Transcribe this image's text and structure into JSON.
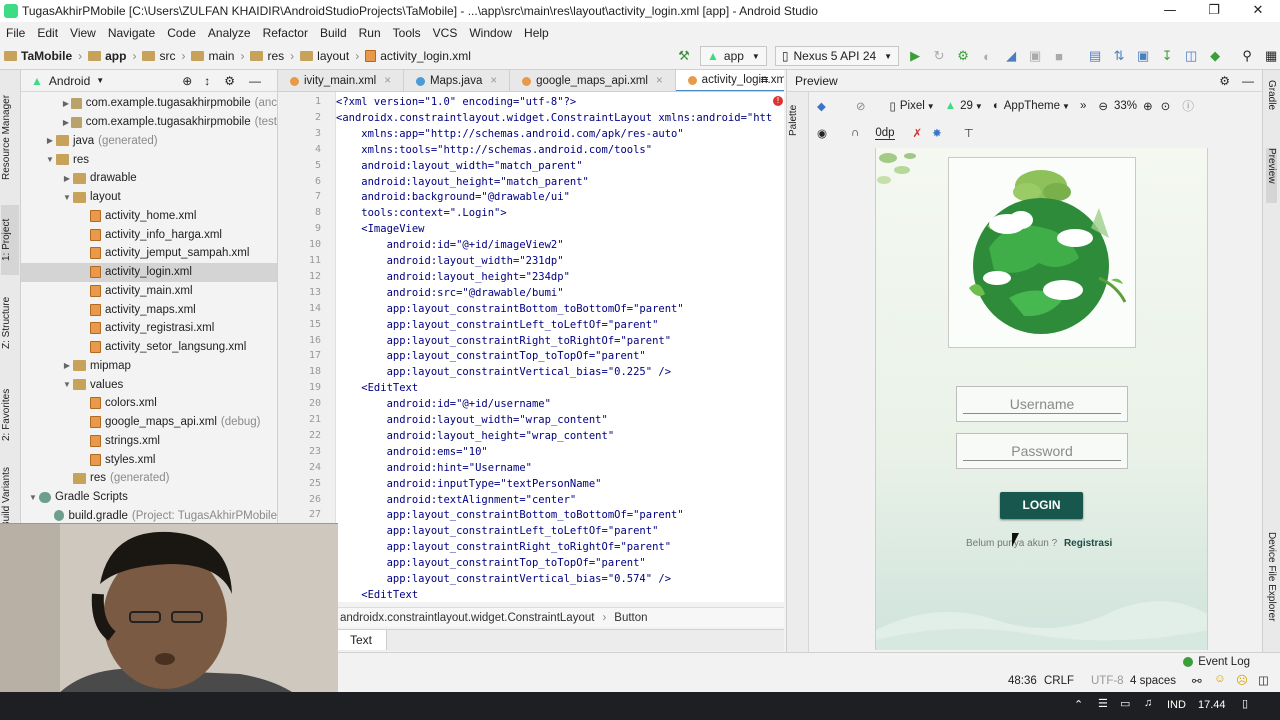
{
  "window": {
    "title": "TugasAkhirPMobile [C:\\Users\\ZULFAN KHAIDIR\\AndroidStudioProjects\\TaMobile] - ...\\app\\src\\main\\res\\layout\\activity_login.xml [app] - Android Studio",
    "minimize_icon": "minimize-icon",
    "restore_icon": "restore-icon",
    "close_icon": "close-icon"
  },
  "menu": [
    "File",
    "Edit",
    "View",
    "Navigate",
    "Code",
    "Analyze",
    "Refactor",
    "Build",
    "Run",
    "Tools",
    "VCS",
    "Window",
    "Help"
  ],
  "breadcrumb": [
    "TaMobile",
    "app",
    "src",
    "main",
    "res",
    "layout",
    "activity_login.xml"
  ],
  "toolbar": {
    "config": "app",
    "device": "Nexus 5 API 24"
  },
  "project_panel": {
    "view": "Android",
    "tree": [
      {
        "label": "com.example.tugasakhirpmobile",
        "suffix": "(anc",
        "depth": 2,
        "arrow": "▶",
        "icon": "pkg"
      },
      {
        "label": "com.example.tugasakhirpmobile",
        "suffix": "(test",
        "depth": 2,
        "arrow": "▶",
        "icon": "pkg"
      },
      {
        "label": "java",
        "suffix": "(generated)",
        "depth": 1,
        "arrow": "▶",
        "icon": "folder-c"
      },
      {
        "label": "res",
        "suffix": "",
        "depth": 1,
        "arrow": "▼",
        "icon": "folder-c"
      },
      {
        "label": "drawable",
        "suffix": "",
        "depth": 2,
        "arrow": "▶",
        "icon": "folder-c"
      },
      {
        "label": "layout",
        "suffix": "",
        "depth": 2,
        "arrow": "▼",
        "icon": "folder-c"
      },
      {
        "label": "activity_home.xml",
        "suffix": "",
        "depth": 3,
        "arrow": "",
        "icon": "xml"
      },
      {
        "label": "activity_info_harga.xml",
        "suffix": "",
        "depth": 3,
        "arrow": "",
        "icon": "xml"
      },
      {
        "label": "activity_jemput_sampah.xml",
        "suffix": "",
        "depth": 3,
        "arrow": "",
        "icon": "xml"
      },
      {
        "label": "activity_login.xml",
        "suffix": "",
        "depth": 3,
        "arrow": "",
        "icon": "xml",
        "selected": true
      },
      {
        "label": "activity_main.xml",
        "suffix": "",
        "depth": 3,
        "arrow": "",
        "icon": "xml"
      },
      {
        "label": "activity_maps.xml",
        "suffix": "",
        "depth": 3,
        "arrow": "",
        "icon": "xml"
      },
      {
        "label": "activity_registrasi.xml",
        "suffix": "",
        "depth": 3,
        "arrow": "",
        "icon": "xml"
      },
      {
        "label": "activity_setor_langsung.xml",
        "suffix": "",
        "depth": 3,
        "arrow": "",
        "icon": "xml"
      },
      {
        "label": "mipmap",
        "suffix": "",
        "depth": 2,
        "arrow": "▶",
        "icon": "folder-c"
      },
      {
        "label": "values",
        "suffix": "",
        "depth": 2,
        "arrow": "▼",
        "icon": "folder-c"
      },
      {
        "label": "colors.xml",
        "suffix": "",
        "depth": 3,
        "arrow": "",
        "icon": "xml"
      },
      {
        "label": "google_maps_api.xml",
        "suffix": "(debug)",
        "depth": 3,
        "arrow": "",
        "icon": "xml"
      },
      {
        "label": "strings.xml",
        "suffix": "",
        "depth": 3,
        "arrow": "",
        "icon": "xml"
      },
      {
        "label": "styles.xml",
        "suffix": "",
        "depth": 3,
        "arrow": "",
        "icon": "xml"
      },
      {
        "label": "res",
        "suffix": "(generated)",
        "depth": 2,
        "arrow": "",
        "icon": "folder-c"
      },
      {
        "label": "Gradle Scripts",
        "suffix": "",
        "depth": 0,
        "arrow": "▼",
        "icon": "gradle"
      },
      {
        "label": "build.gradle",
        "suffix": "(Project: TugasAkhirPMobile",
        "depth": 1,
        "arrow": "",
        "icon": "gradle"
      }
    ]
  },
  "left_strip_tabs": [
    "Resource Manager",
    "1: Project",
    "Z: Structure",
    "2: Favorites",
    "Build Variants"
  ],
  "editor_tabs": [
    {
      "label": "ivity_main.xml",
      "dot": "#e89a4a"
    },
    {
      "label": "Maps.java",
      "dot": "#4a9cd6"
    },
    {
      "label": "google_maps_api.xml",
      "dot": "#e89a4a"
    },
    {
      "label": "activity_login.xml",
      "dot": "#e89a4a",
      "active": true
    }
  ],
  "code": {
    "start_line": 1,
    "lines": [
      "<?xml version=\"1.0\" encoding=\"utf-8\"?>",
      "<androidx.constraintlayout.widget.ConstraintLayout xmlns:android=\"htt",
      "    xmlns:app=\"http://schemas.android.com/apk/res-auto\"",
      "    xmlns:tools=\"http://schemas.android.com/tools\"",
      "    android:layout_width=\"match_parent\"",
      "    android:layout_height=\"match_parent\"",
      "    android:background=\"@drawable/ui\"",
      "    tools:context=\".Login\">",
      "    <ImageView",
      "        android:id=\"@+id/imageView2\"",
      "        android:layout_width=\"231dp\"",
      "        android:layout_height=\"234dp\"",
      "        android:src=\"@drawable/bumi\"",
      "        app:layout_constraintBottom_toBottomOf=\"parent\"",
      "        app:layout_constraintLeft_toLeftOf=\"parent\"",
      "        app:layout_constraintRight_toRightOf=\"parent\"",
      "        app:layout_constraintTop_toTopOf=\"parent\"",
      "        app:layout_constraintVertical_bias=\"0.225\" />",
      "    <EditText",
      "        android:id=\"@+id/username\"",
      "        android:layout_width=\"wrap_content\"",
      "        android:layout_height=\"wrap_content\"",
      "        android:ems=\"10\"",
      "        android:hint=\"Username\"",
      "        android:inputType=\"textPersonName\"",
      "        android:textAlignment=\"center\"",
      "        app:layout_constraintBottom_toBottomOf=\"parent\"",
      "        app:layout_constraintLeft_toLeftOf=\"parent\"",
      "        app:layout_constraintRight_toRightOf=\"parent\"",
      "        app:layout_constraintTop_toTopOf=\"parent\"",
      "        app:layout_constraintVertical_bias=\"0.574\" />",
      "    <EditText"
    ]
  },
  "editor_breadcrumb": [
    "androidx.constraintlayout.widget.ConstraintLayout",
    "Button"
  ],
  "bottom_tabs": [
    "Text"
  ],
  "preview": {
    "title": "Preview",
    "device": "Pixel",
    "api": "29",
    "theme": "AppTheme",
    "zoom": "33%",
    "margin": "0dp",
    "username_hint": "Username",
    "password_hint": "Password",
    "login_label": "LOGIN",
    "signup_prompt": "Belum punya akun ?",
    "signup_link": "Registrasi"
  },
  "right_strip_tabs": [
    "Gradle",
    "Preview",
    "Device File Explorer"
  ],
  "status": {
    "event_log": "Event Log",
    "position": "48:36",
    "line_sep": "CRLF",
    "encoding": "UTF-8",
    "indent": "4 spaces"
  },
  "taskbar": {
    "lang": "IND",
    "time": "17.44"
  },
  "colors": {
    "login_button": "#17574d",
    "accent_tab": "#4a88c7"
  }
}
